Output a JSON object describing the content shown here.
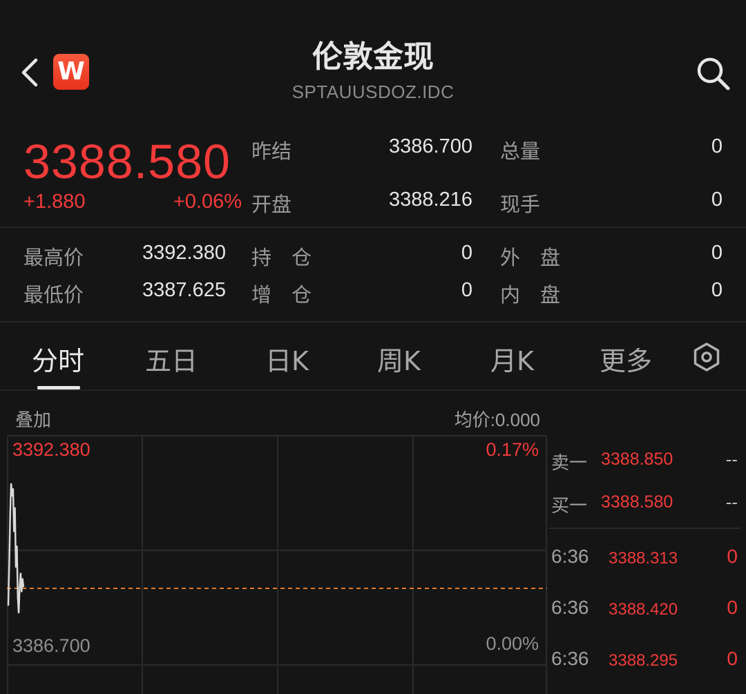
{
  "header": {
    "title": "伦敦金现",
    "code": "SPTAUUSDOZ.IDC",
    "logo_letter": "W"
  },
  "quote": {
    "price": "3388.580",
    "change": "+1.880",
    "change_pct": "+0.06%",
    "price_color": "#f23a3a",
    "fields": [
      {
        "label": "昨结",
        "value": "3386.700"
      },
      {
        "label": "总量",
        "value": "0"
      },
      {
        "label": "开盘",
        "value": "3388.216"
      },
      {
        "label": "现手",
        "value": "0"
      }
    ]
  },
  "stats": {
    "high_label": "最高价",
    "high": "3392.380",
    "low_label": "最低价",
    "low": "3387.625",
    "oi_label": "持　仓",
    "oi": "0",
    "oi_chg_label": "增　仓",
    "oi_chg": "0",
    "outer_label": "外　盘",
    "outer": "0",
    "inner_label": "内　盘",
    "inner": "0"
  },
  "tabs": [
    {
      "label": "分时",
      "active": true
    },
    {
      "label": "五日"
    },
    {
      "label": "日K"
    },
    {
      "label": "周K"
    },
    {
      "label": "月K"
    },
    {
      "label": "更多"
    }
  ],
  "chart": {
    "overlay_label": "叠加",
    "avg_price": "均价:0.000",
    "top_price": "3392.380",
    "top_pct": "0.17%",
    "bottom_price": "3386.700",
    "bottom_pct": "0.00%"
  },
  "chart_data": {
    "type": "line",
    "ylim": [
      3386.7,
      3392.38
    ],
    "reference": 3386.7,
    "series": [
      {
        "values": [
          3387.9,
          3389.5,
          3391.3,
          3392.38,
          3391.9,
          3392.2,
          3390.6,
          3391.5,
          3389.3,
          3390.1,
          3388.2,
          3387.625,
          3388.6,
          3389.1,
          3388.4,
          3388.9,
          3388.58
        ]
      }
    ]
  },
  "orderbook": {
    "ask_label": "卖一",
    "ask_price": "3388.850",
    "ask_vol": "--",
    "bid_label": "买一",
    "bid_price": "3388.580",
    "bid_vol": "--"
  },
  "ticks": [
    {
      "time": "6:36",
      "price": "3388.313",
      "vol": "0"
    },
    {
      "time": "6:36",
      "price": "3388.420",
      "vol": "0"
    },
    {
      "time": "6:36",
      "price": "3388.295",
      "vol": "0"
    }
  ]
}
